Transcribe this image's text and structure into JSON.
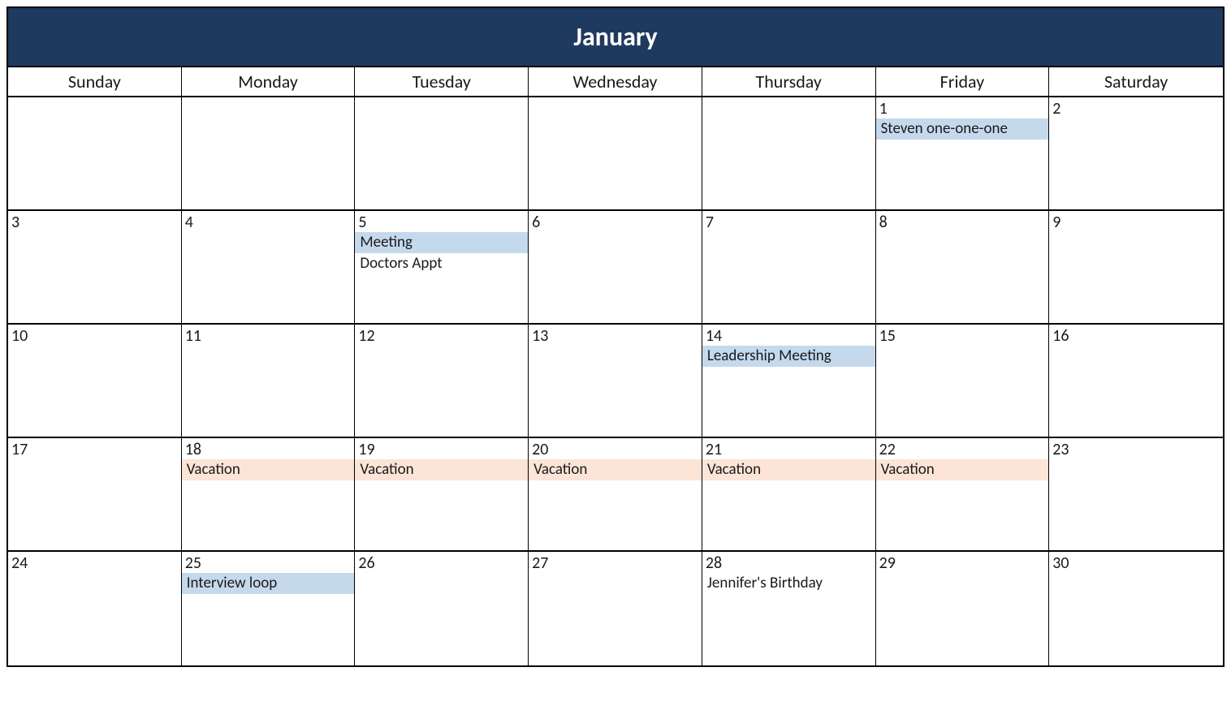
{
  "month": "January",
  "dayHeaders": [
    "Sunday",
    "Monday",
    "Tuesday",
    "Wednesday",
    "Thursday",
    "Friday",
    "Saturday"
  ],
  "colors": {
    "header_bg": "#1f3a5f",
    "highlight_blue": "#c5d9ed",
    "highlight_peach": "#fce4d6"
  },
  "weeks": [
    [
      {
        "num": "",
        "events": []
      },
      {
        "num": "",
        "events": []
      },
      {
        "num": "",
        "events": []
      },
      {
        "num": "",
        "events": []
      },
      {
        "num": "",
        "events": []
      },
      {
        "num": "1",
        "events": [
          {
            "text": "Steven one-one-one",
            "style": "highlight-blue"
          }
        ]
      },
      {
        "num": "2",
        "events": []
      }
    ],
    [
      {
        "num": "3",
        "events": []
      },
      {
        "num": "4",
        "events": []
      },
      {
        "num": "5",
        "events": [
          {
            "text": "Meeting",
            "style": "highlight-blue"
          },
          {
            "text": "Doctors Appt",
            "style": ""
          }
        ]
      },
      {
        "num": "6",
        "events": []
      },
      {
        "num": "7",
        "events": []
      },
      {
        "num": "8",
        "events": []
      },
      {
        "num": "9",
        "events": []
      }
    ],
    [
      {
        "num": "10",
        "events": []
      },
      {
        "num": "11",
        "events": []
      },
      {
        "num": "12",
        "events": []
      },
      {
        "num": "13",
        "events": []
      },
      {
        "num": "14",
        "events": [
          {
            "text": "Leadership Meeting",
            "style": "highlight-blue"
          }
        ]
      },
      {
        "num": "15",
        "events": []
      },
      {
        "num": "16",
        "events": []
      }
    ],
    [
      {
        "num": "17",
        "events": []
      },
      {
        "num": "18",
        "events": [
          {
            "text": "Vacation",
            "style": "highlight-peach"
          }
        ]
      },
      {
        "num": "19",
        "events": [
          {
            "text": "Vacation",
            "style": "highlight-peach"
          }
        ]
      },
      {
        "num": "20",
        "events": [
          {
            "text": "Vacation",
            "style": "highlight-peach"
          }
        ]
      },
      {
        "num": "21",
        "events": [
          {
            "text": "Vacation",
            "style": "highlight-peach"
          }
        ]
      },
      {
        "num": "22",
        "events": [
          {
            "text": "Vacation",
            "style": "highlight-peach"
          }
        ]
      },
      {
        "num": "23",
        "events": []
      }
    ],
    [
      {
        "num": "24",
        "events": []
      },
      {
        "num": "25",
        "events": [
          {
            "text": "Interview loop",
            "style": "highlight-blue"
          }
        ]
      },
      {
        "num": "26",
        "events": []
      },
      {
        "num": "27",
        "events": []
      },
      {
        "num": "28",
        "events": [
          {
            "text": "Jennifer's Birthday",
            "style": ""
          }
        ]
      },
      {
        "num": "29",
        "events": []
      },
      {
        "num": "30",
        "events": []
      }
    ]
  ]
}
